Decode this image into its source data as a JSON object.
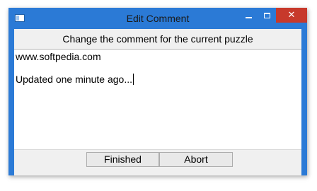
{
  "window": {
    "title": "Edit Comment",
    "controls": {
      "minimize": "minimize",
      "maximize": "maximize",
      "close": "✕"
    }
  },
  "dialog": {
    "instruction": "Change the comment for the current puzzle",
    "comment_lines": [
      "www.softpedia.com",
      "Updated one minute ago..."
    ]
  },
  "buttons": {
    "finished": "Finished",
    "abort": "Abort"
  },
  "colors": {
    "titlebar": "#2b7ad6",
    "close_button": "#c7392b",
    "client": "#f0f0f0"
  },
  "icons": {
    "app": "app-window-icon",
    "minimize": "minimize-icon",
    "maximize": "maximize-icon",
    "close": "close-icon"
  }
}
